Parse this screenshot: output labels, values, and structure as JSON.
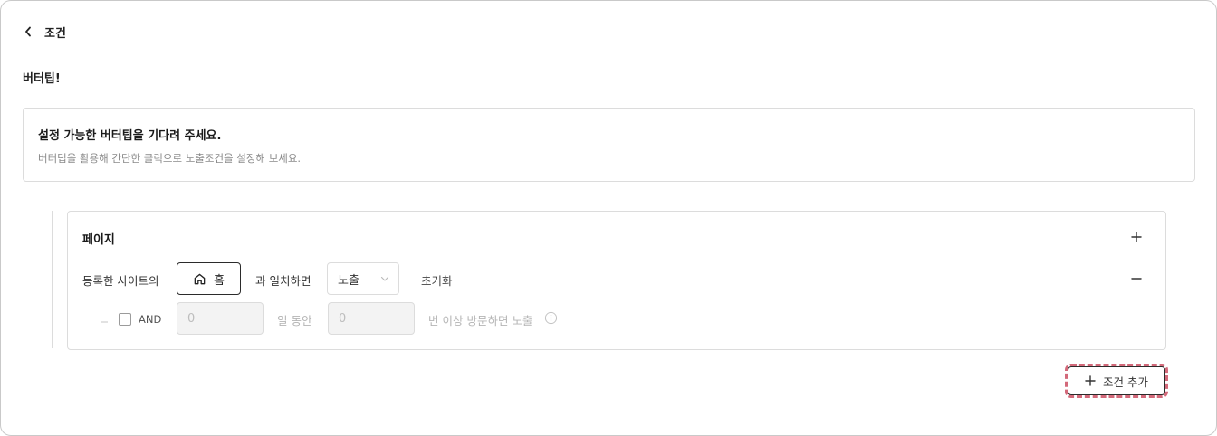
{
  "header": {
    "title": "조건",
    "back_icon": "chevron-left-icon"
  },
  "section": {
    "title": "버터팁!"
  },
  "notice": {
    "title": "설정 가능한 버터팁을 기다려 주세요.",
    "description": "버터팁을 활용해 간단한 클릭으로 노출조건을 설정해 보세요."
  },
  "condition": {
    "title": "페이지",
    "registered_site_label": "등록한 사이트의",
    "home_chip": {
      "label": "홈",
      "icon": "home-icon"
    },
    "match_label": "과 일치하면",
    "display_select": {
      "value": "노출",
      "icon": "chevron-down-icon"
    },
    "reset_label": "초기화",
    "sub_rule": {
      "and_label": "AND",
      "days_placeholder": "0",
      "days_suffix": "일 동안",
      "visits_placeholder": "0",
      "visits_suffix": "번 이상 방문하면 노출",
      "info_icon": "info-icon"
    }
  },
  "add_condition": {
    "label": "조건 추가",
    "icon": "plus-icon"
  },
  "colors": {
    "highlight_border": "#d3697a",
    "border": "#dcdcdc",
    "disabled_bg": "#f3f3f3"
  }
}
